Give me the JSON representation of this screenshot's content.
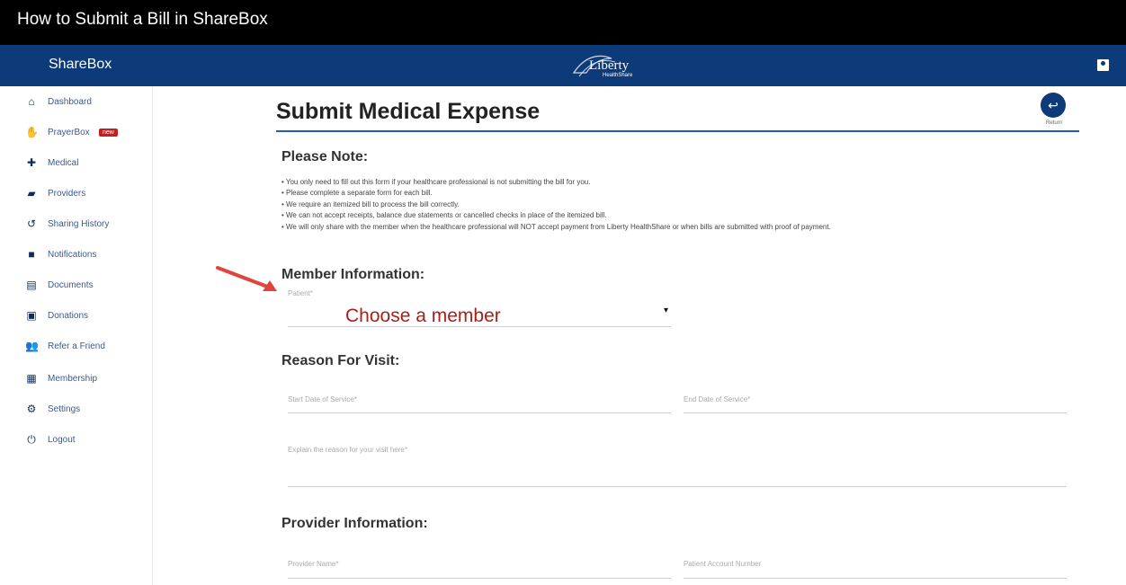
{
  "video": {
    "title": "How to Submit a Bill in ShareBox"
  },
  "app": {
    "brand": "ShareBox",
    "logo_text": "Liberty",
    "logo_sub": "HealthShare"
  },
  "sidebar": {
    "items": [
      {
        "label": "Dashboard",
        "icon": "home-icon"
      },
      {
        "label": "PrayerBox",
        "icon": "prayer-icon",
        "badge": "new"
      },
      {
        "label": "Medical",
        "icon": "medical-icon"
      },
      {
        "label": "Providers",
        "icon": "providers-icon"
      },
      {
        "label": "Sharing History",
        "icon": "history-icon"
      },
      {
        "label": "Notifications",
        "icon": "notification-icon"
      },
      {
        "label": "Documents",
        "icon": "document-icon"
      },
      {
        "label": "Donations",
        "icon": "donation-icon"
      },
      {
        "label": "Refer a Friend",
        "icon": "people-icon"
      },
      {
        "label": "Membership",
        "icon": "membership-icon"
      },
      {
        "label": "Settings",
        "icon": "gear-icon"
      },
      {
        "label": "Logout",
        "icon": "power-icon"
      }
    ]
  },
  "page": {
    "title": "Submit Medical Expense",
    "return_label": "Return"
  },
  "note": {
    "heading": "Please Note:",
    "lines": [
      "• You only need to fill out this form if your healthcare professional is not submitting the bill for you.",
      "• Please complete a separate form for each bill.",
      "• We require an itemized bill to process the bill correctly.",
      "• We can not accept receipts, balance due statements or cancelled checks in place of the itemized bill.",
      "• We will only share with the member when the healthcare professional will NOT accept payment from Liberty HealthShare or when bills are submitted with proof of payment."
    ]
  },
  "member": {
    "heading": "Member Information:",
    "patient_label": "Patient*",
    "patient_value": "Choose a member",
    "caret": "▾"
  },
  "visit": {
    "heading": "Reason For Visit:",
    "start_label": "Start Date of Service*",
    "end_label": "End Date of Service*",
    "reason_label": "Explain the reason for your visit here*"
  },
  "provider": {
    "heading": "Provider Information:",
    "name_label": "Provider Name*",
    "account_label": "Patient Account Number"
  },
  "colors": {
    "navy": "#0d3a78",
    "accent_blue": "#1d5fb8",
    "annotation_red": "#a8201a",
    "arrow": "#e0443c"
  }
}
